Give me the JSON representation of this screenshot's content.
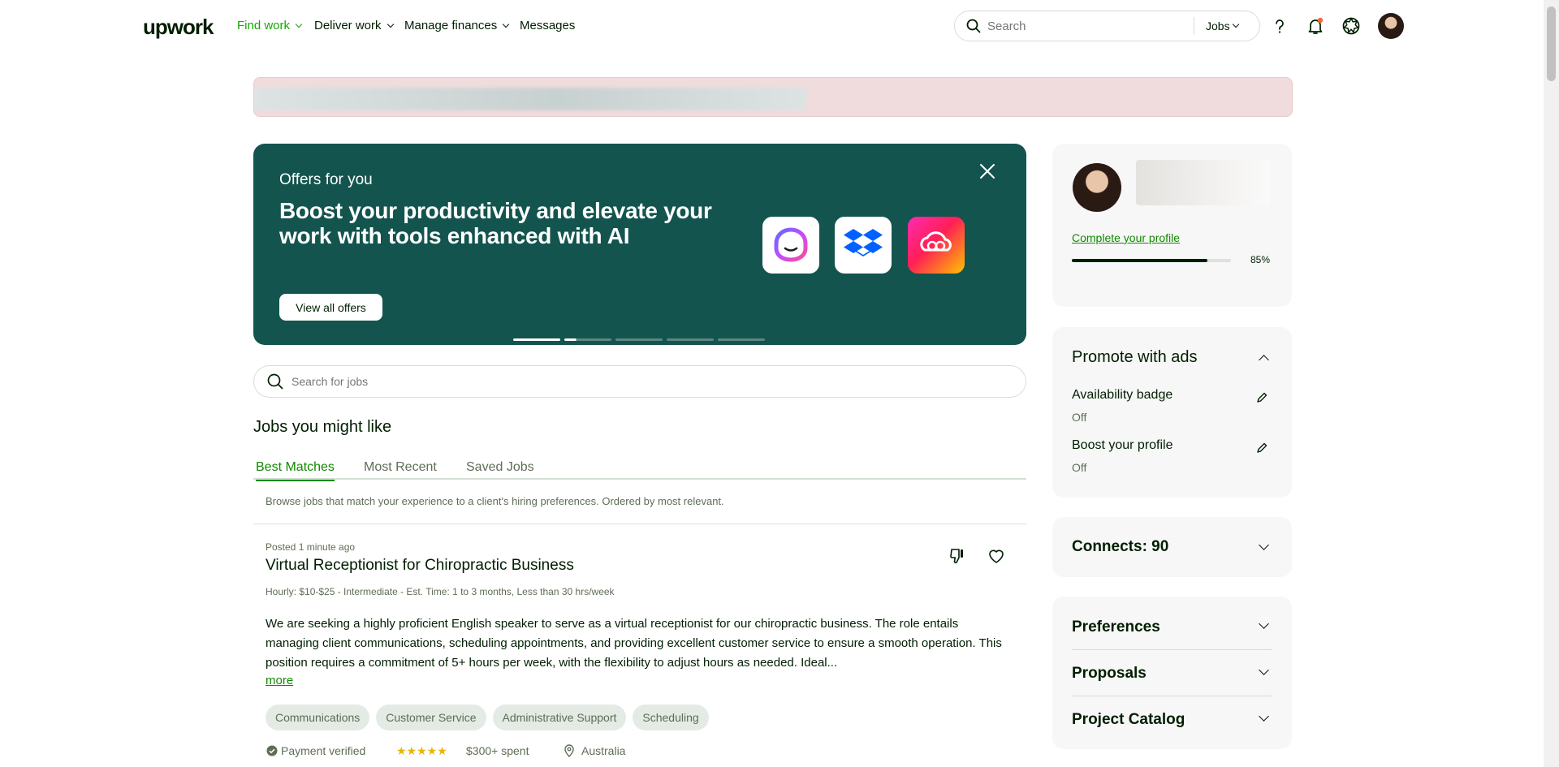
{
  "header": {
    "logo": "upwork",
    "nav": [
      {
        "label": "Find work",
        "active": true,
        "dropdown": true
      },
      {
        "label": "Deliver work",
        "dropdown": true
      },
      {
        "label": "Manage finances",
        "dropdown": true
      },
      {
        "label": "Messages",
        "dropdown": false
      }
    ],
    "search_placeholder": "Search",
    "search_scope": "Jobs"
  },
  "promo": {
    "eyebrow": "Offers for you",
    "headline": "Boost your productivity and elevate your work with tools enhanced with AI",
    "button": "View all offers",
    "icons": [
      "jasper-icon",
      "dropbox-icon",
      "creative-cloud-icon"
    ]
  },
  "job_search": {
    "placeholder": "Search for jobs"
  },
  "feed": {
    "title": "Jobs you might like",
    "tabs": [
      "Best Matches",
      "Most Recent",
      "Saved Jobs"
    ],
    "active_tab": "Best Matches",
    "description": "Browse jobs that match your experience to a client's hiring preferences. Ordered by most relevant.",
    "job": {
      "posted": "Posted 1 minute ago",
      "title": "Virtual Receptionist for Chiropractic Business",
      "meta": "Hourly: $10-$25 - Intermediate - Est. Time: 1 to 3 months, Less than 30 hrs/week",
      "description": "We are seeking a highly proficient English speaker to serve as a virtual receptionist for our chiropractic business. The role entails managing client communications, scheduling appointments, and providing excellent customer service to ensure a smooth operation. This position requires a commitment of 5+ hours per week, with the flexibility to adjust hours as needed. Ideal...",
      "more": "more",
      "tags": [
        "Communications",
        "Customer Service",
        "Administrative Support",
        "Scheduling"
      ],
      "payment": "Payment verified",
      "rating_stars": 5,
      "spent": "$300+ spent",
      "location": "Australia"
    }
  },
  "sidebar": {
    "profile": {
      "complete_link": "Complete your profile",
      "progress_percent": 85,
      "progress_label": "85%"
    },
    "promote": {
      "title": "Promote with ads",
      "items": [
        {
          "label": "Availability badge",
          "status": "Off"
        },
        {
          "label": "Boost your profile",
          "status": "Off"
        }
      ]
    },
    "connects": "Connects: 90",
    "sections": [
      "Preferences",
      "Proposals",
      "Project Catalog"
    ]
  },
  "colors": {
    "brand_green": "#14a800",
    "promo_bg": "#13544e",
    "alert_bg": "#f0dcdc"
  }
}
